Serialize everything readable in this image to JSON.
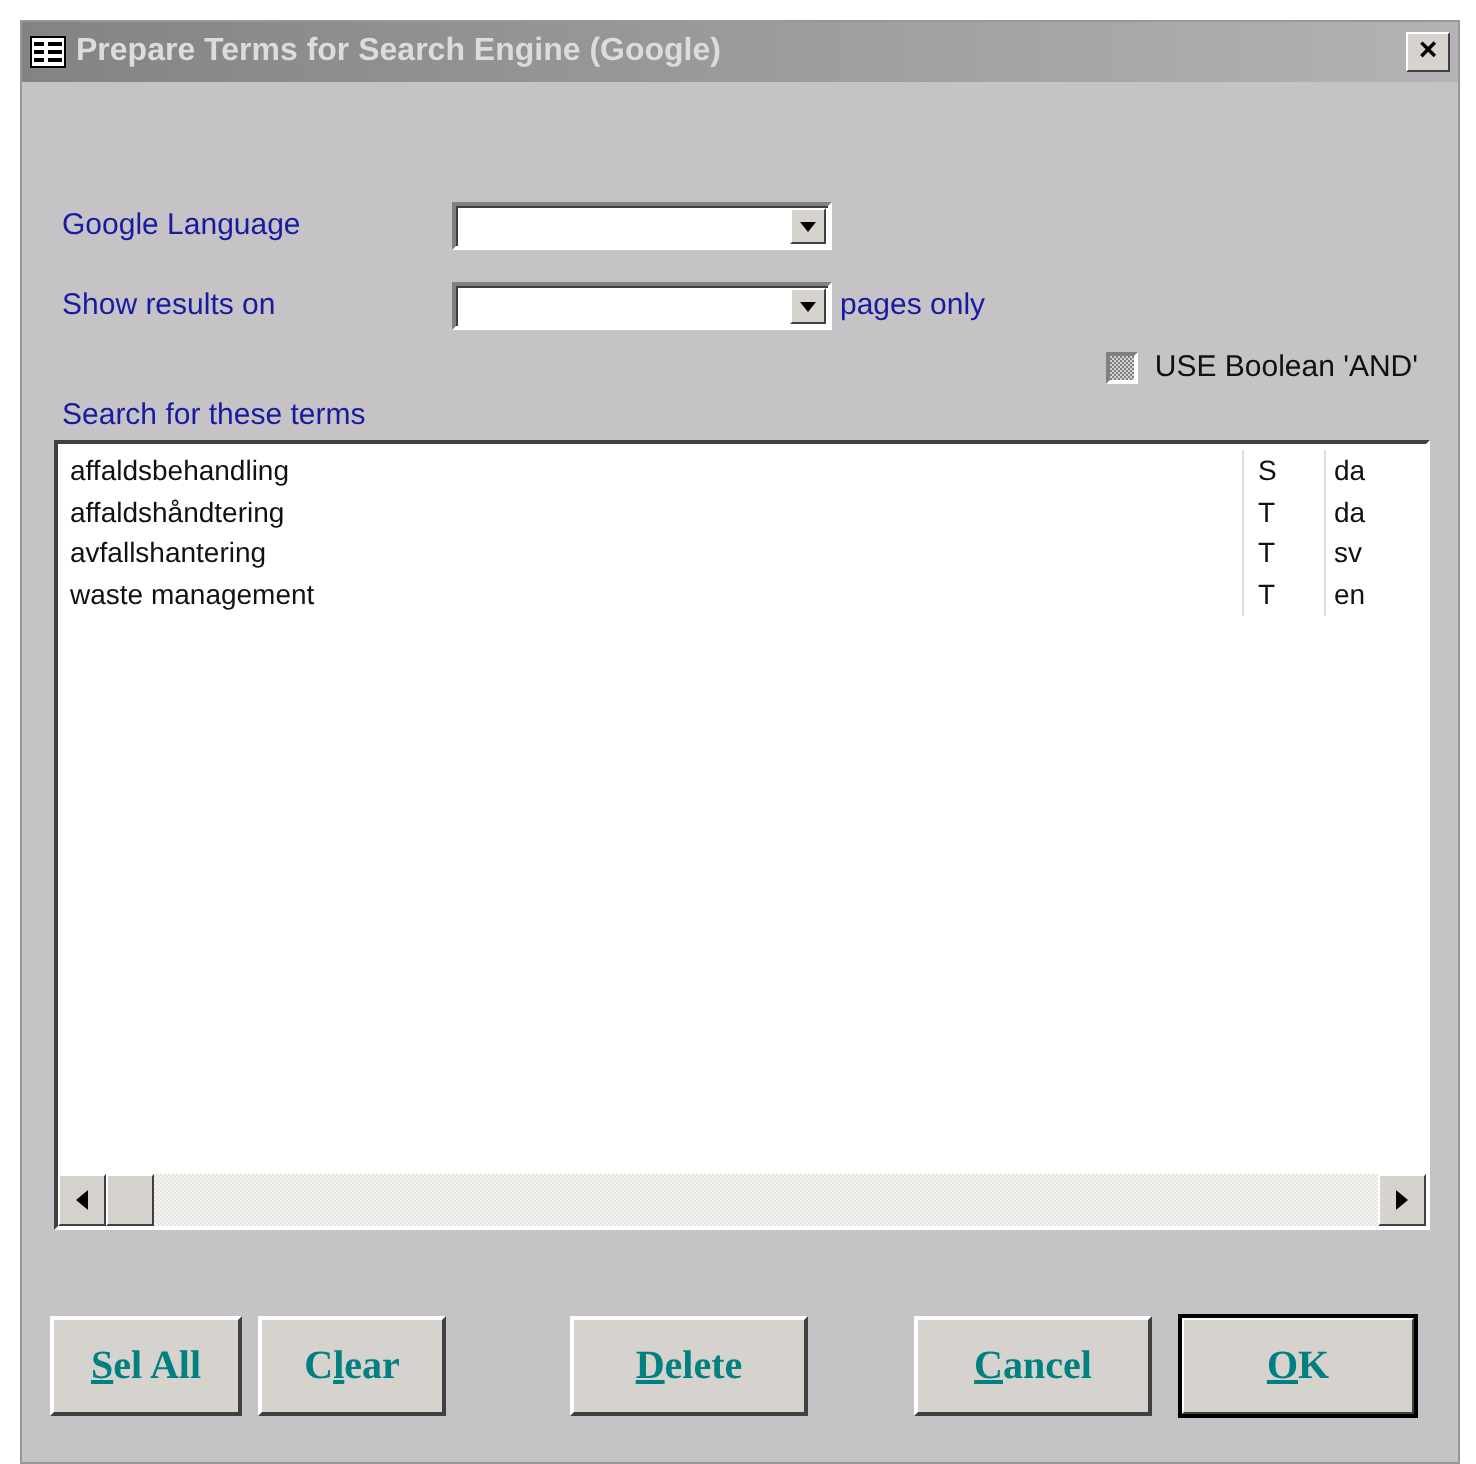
{
  "window": {
    "title": "Prepare Terms for Search Engine (Google)",
    "close": "×"
  },
  "fields": [
    {
      "label": "Google Language"
    },
    {
      "label": "Show results on",
      "suffix": "pages only"
    }
  ],
  "boolean_checkbox": {
    "label": "USE Boolean 'AND'",
    "indeterminate": true
  },
  "terms_label": "Search for these terms",
  "terms": [
    {
      "term": "affaldsbehandling",
      "type": "S",
      "lang": "da"
    },
    {
      "term": "affaldshåndtering",
      "type": "T",
      "lang": "da"
    },
    {
      "term": "avfallshantering",
      "type": "T",
      "lang": "sv"
    },
    {
      "term": "waste management",
      "type": "T",
      "lang": "en"
    }
  ],
  "buttons": [
    {
      "key": "S",
      "after": "el All",
      "default": false
    },
    {
      "before": "C",
      "key": "l",
      "after": "ear",
      "default": false
    },
    {
      "key": "D",
      "after": "elete",
      "default": false
    },
    {
      "key": "C",
      "after": "ancel",
      "default": false
    },
    {
      "key": "O",
      "after": "K",
      "default": true
    }
  ]
}
